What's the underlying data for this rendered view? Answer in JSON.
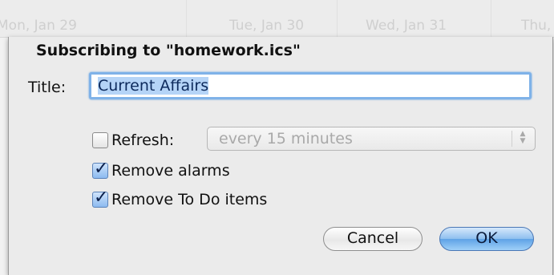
{
  "background_calendar": {
    "days": [
      "Mon, Jan 29",
      "Tue, Jan 30",
      "Wed, Jan 31",
      "Thu,"
    ]
  },
  "dialog": {
    "title": "Subscribing to \"homework.ics\"",
    "title_field": {
      "label": "Title:",
      "value": "Current Affairs",
      "selected": true
    },
    "refresh": {
      "label": "Refresh:",
      "checked": false,
      "popup_value": "every 15 minutes",
      "popup_enabled": false
    },
    "remove_alarms": {
      "label": "Remove alarms",
      "checked": true
    },
    "remove_todo": {
      "label": "Remove To Do items",
      "checked": true
    },
    "buttons": {
      "cancel": "Cancel",
      "ok": "OK"
    }
  },
  "colors": {
    "focus_ring": "#7fb2e8",
    "selection": "#b5d4f7",
    "default_button": "#5ea2e6"
  }
}
